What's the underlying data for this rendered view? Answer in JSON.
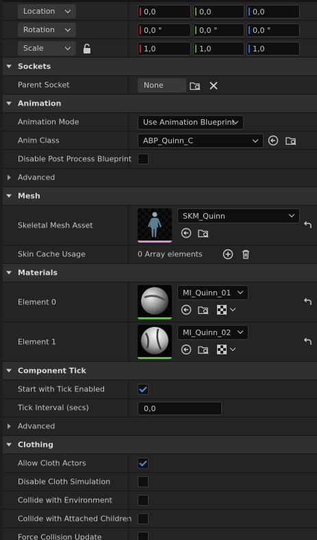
{
  "transform": {
    "location": {
      "label": "Location",
      "x": "0,0",
      "y": "0,0",
      "z": "0,0"
    },
    "rotation": {
      "label": "Rotation",
      "x": "0,0 °",
      "y": "0,0 °",
      "z": "0,0 °"
    },
    "scale": {
      "label": "Scale",
      "x": "1,0",
      "y": "1,0",
      "z": "1,0"
    }
  },
  "axis_colors": {
    "x": "#c1272d",
    "y": "#5a9b3a",
    "z": "#2f6bd6"
  },
  "accent": "#3a9bff",
  "sockets": {
    "title": "Sockets",
    "parent_socket_label": "Parent Socket",
    "parent_socket_value": "None"
  },
  "animation": {
    "title": "Animation",
    "mode_label": "Animation Mode",
    "mode_value": "Use Animation Blueprint",
    "anim_class_label": "Anim Class",
    "anim_class_value": "ABP_Quinn_C",
    "disable_post_label": "Disable Post Process Blueprint",
    "disable_post_checked": false,
    "advanced_label": "Advanced"
  },
  "mesh": {
    "title": "Mesh",
    "asset_label": "Skeletal Mesh Asset",
    "asset_value": "SKM_Quinn",
    "skin_cache_label": "Skin Cache Usage",
    "skin_cache_value": "0 Array elements"
  },
  "materials": {
    "title": "Materials",
    "elements": [
      {
        "label": "Element 0",
        "value": "MI_Quinn_01"
      },
      {
        "label": "Element 1",
        "value": "MI_Quinn_02"
      }
    ]
  },
  "component_tick": {
    "title": "Component Tick",
    "start_label": "Start with Tick Enabled",
    "start_checked": true,
    "interval_label": "Tick Interval (secs)",
    "interval_value": "0,0",
    "advanced_label": "Advanced"
  },
  "clothing": {
    "title": "Clothing",
    "allow_label": "Allow Cloth Actors",
    "allow_checked": true,
    "disable_sim_label": "Disable Cloth Simulation",
    "collide_env_label": "Collide with Environment",
    "collide_attached_label": "Collide with Attached Children",
    "force_collision_label": "Force Collision Update"
  }
}
